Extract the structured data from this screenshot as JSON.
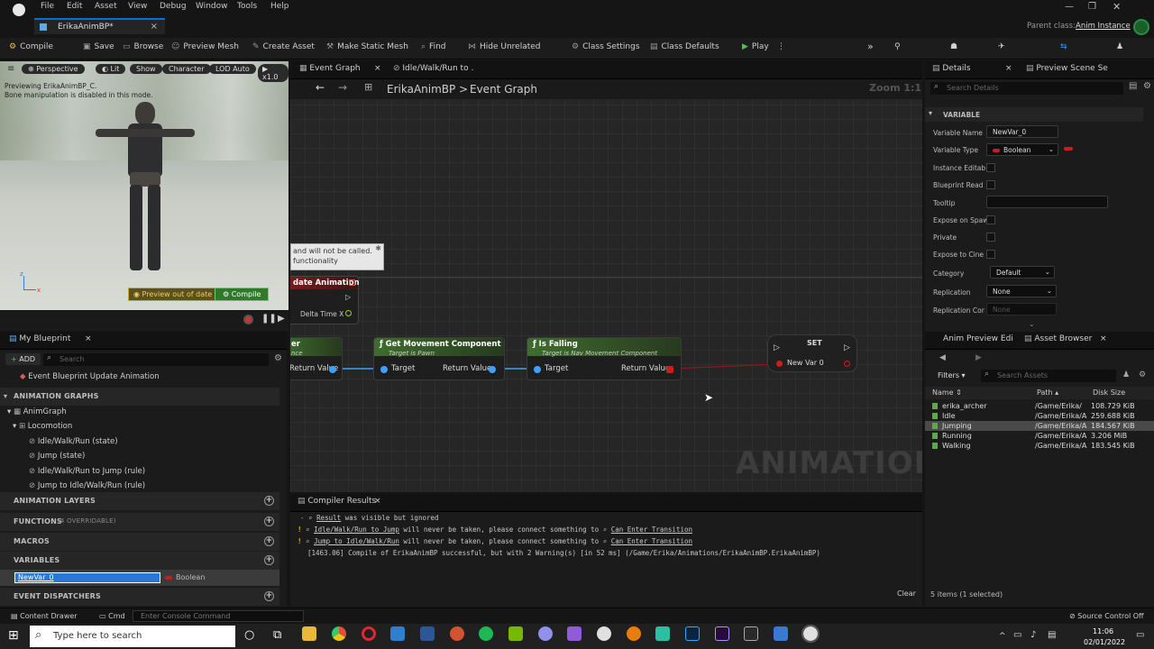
{
  "menu": [
    "File",
    "Edit",
    "Asset",
    "View",
    "Debug",
    "Window",
    "Tools",
    "Help"
  ],
  "window_tab": "ErikaAnimBP*",
  "parent_class": {
    "label": "Parent class:",
    "value": "Anim Instance"
  },
  "toolbar": {
    "compile": "Compile",
    "save": "Save",
    "browse": "Browse",
    "preview_mesh": "Preview Mesh",
    "create_asset": "Create Asset",
    "make_static_mesh": "Make Static Mesh",
    "find": "Find",
    "hide_unrelated": "Hide Unrelated",
    "class_settings": "Class Settings",
    "class_defaults": "Class Defaults",
    "play": "Play"
  },
  "viewport": {
    "perspective": "Perspective",
    "lit": "Lit",
    "show": "Show",
    "character": "Character",
    "lod": "LOD Auto",
    "speed": "x1.0",
    "preview_line1": "Previewing ErikaAnimBP_C.",
    "preview_line2": "Bone manipulation is disabled in this mode.",
    "preview_out_of_date": "Preview out of date",
    "compile": "Compile"
  },
  "my_blueprint": {
    "tab": "My Blueprint",
    "add": "ADD",
    "search_placeholder": "Search",
    "event_item": "Event Blueprint Update Animation",
    "sections": {
      "anim_graphs": "ANIMATION GRAPHS",
      "anim_layers": "ANIMATION LAYERS",
      "functions": "FUNCTIONS",
      "functions_count": "(4 OVERRIDABLE)",
      "macros": "MACROS",
      "variables": "VARIABLES",
      "dispatchers": "EVENT DISPATCHERS"
    },
    "tree": [
      "AnimGraph",
      "Locomotion",
      "Idle/Walk/Run (state)",
      "Jump (state)",
      "Idle/Walk/Run to Jump (rule)",
      "Jump to Idle/Walk/Run (rule)"
    ],
    "variable": {
      "name": "NewVar_0",
      "type": "Boolean"
    }
  },
  "graph": {
    "tabs": [
      "Event Graph",
      "Idle/Walk/Run to ."
    ],
    "breadcrumb_root": "ErikaAnimBP",
    "breadcrumb_sep": ">",
    "breadcrumb_leaf": "Event Graph",
    "zoom": "Zoom 1:1",
    "watermark": "ANIMATION",
    "comment_line1": "and will not be called.",
    "comment_line2": "functionality",
    "update_anim": "date Animation",
    "delta_time": "Delta Time X",
    "node_partial": {
      "title": "er",
      "sub": "nce",
      "ret": "Return Value"
    },
    "node_gmc": {
      "title": "Get Movement Component",
      "sub": "Target is Pawn",
      "target": "Target",
      "ret": "Return Value"
    },
    "node_falling": {
      "title": "Is Falling",
      "sub": "Target is Nav Movement Component",
      "target": "Target",
      "ret": "Return Value"
    },
    "node_set": {
      "title": "SET",
      "var": "New Var 0"
    }
  },
  "compiler": {
    "tab": "Compiler Results",
    "clear": "Clear",
    "lines": [
      {
        "link": "Result",
        "text": " was visible but ignored"
      },
      {
        "link": "Idle/Walk/Run to Jump",
        "text": " will never be taken, please connect something to ",
        "link2": "Can Enter Transition"
      },
      {
        "link": "Jump to Idle/Walk/Run",
        "text": " will never be taken, please connect something to ",
        "link2": "Can Enter Transition"
      }
    ],
    "summary": "[1463.06] Compile of ErikaAnimBP successful, but with 2 Warning(s) [in 52 ms] (/Game/Erika/Animations/ErikaAnimBP.ErikaAnimBP)"
  },
  "details": {
    "tab": "Details",
    "tab2": "Preview Scene Se",
    "search_placeholder": "Search Details",
    "section": "VARIABLE",
    "rows": {
      "var_name": "Variable Name",
      "var_type": "Variable Type",
      "instance": "Instance Editab",
      "bp_read": "Blueprint Read",
      "tooltip": "Tooltip",
      "expose_spawn": "Expose on Spaw",
      "private": "Private",
      "expose_cine": "Expose to Cine",
      "category": "Category",
      "replication": "Replication",
      "rep_cond": "Replication Cor"
    },
    "values": {
      "var_name": "NewVar_0",
      "var_type": "Boolean",
      "category": "Default",
      "replication": "None",
      "rep_cond": "None"
    }
  },
  "asset_browser": {
    "tab1": "Anim Preview Edi",
    "tab2": "Asset Browser",
    "filters": "Filters",
    "search_placeholder": "Search Assets",
    "headers": [
      "Name",
      "Path",
      "Disk Size"
    ],
    "assets": [
      {
        "name": "erika_archer",
        "path": "/Game/Erika/",
        "size": "108.729 KiB"
      },
      {
        "name": "Idle",
        "path": "/Game/Erika/A",
        "size": "259.688 KiB"
      },
      {
        "name": "Jumping",
        "path": "/Game/Erika/A",
        "size": "184.567 KiB"
      },
      {
        "name": "Running",
        "path": "/Game/Erika/A",
        "size": "3.206 MiB"
      },
      {
        "name": "Walking",
        "path": "/Game/Erika/A",
        "size": "183.545 KiB"
      }
    ],
    "status": "5 items (1 selected)"
  },
  "bottom": {
    "content_drawer": "Content Drawer",
    "cmd": "Cmd",
    "console_placeholder": "Enter Console Command",
    "source_control": "Source Control Off"
  },
  "taskbar": {
    "search_placeholder": "Type here to search",
    "time": "11:06",
    "date": "02/01/2022"
  }
}
